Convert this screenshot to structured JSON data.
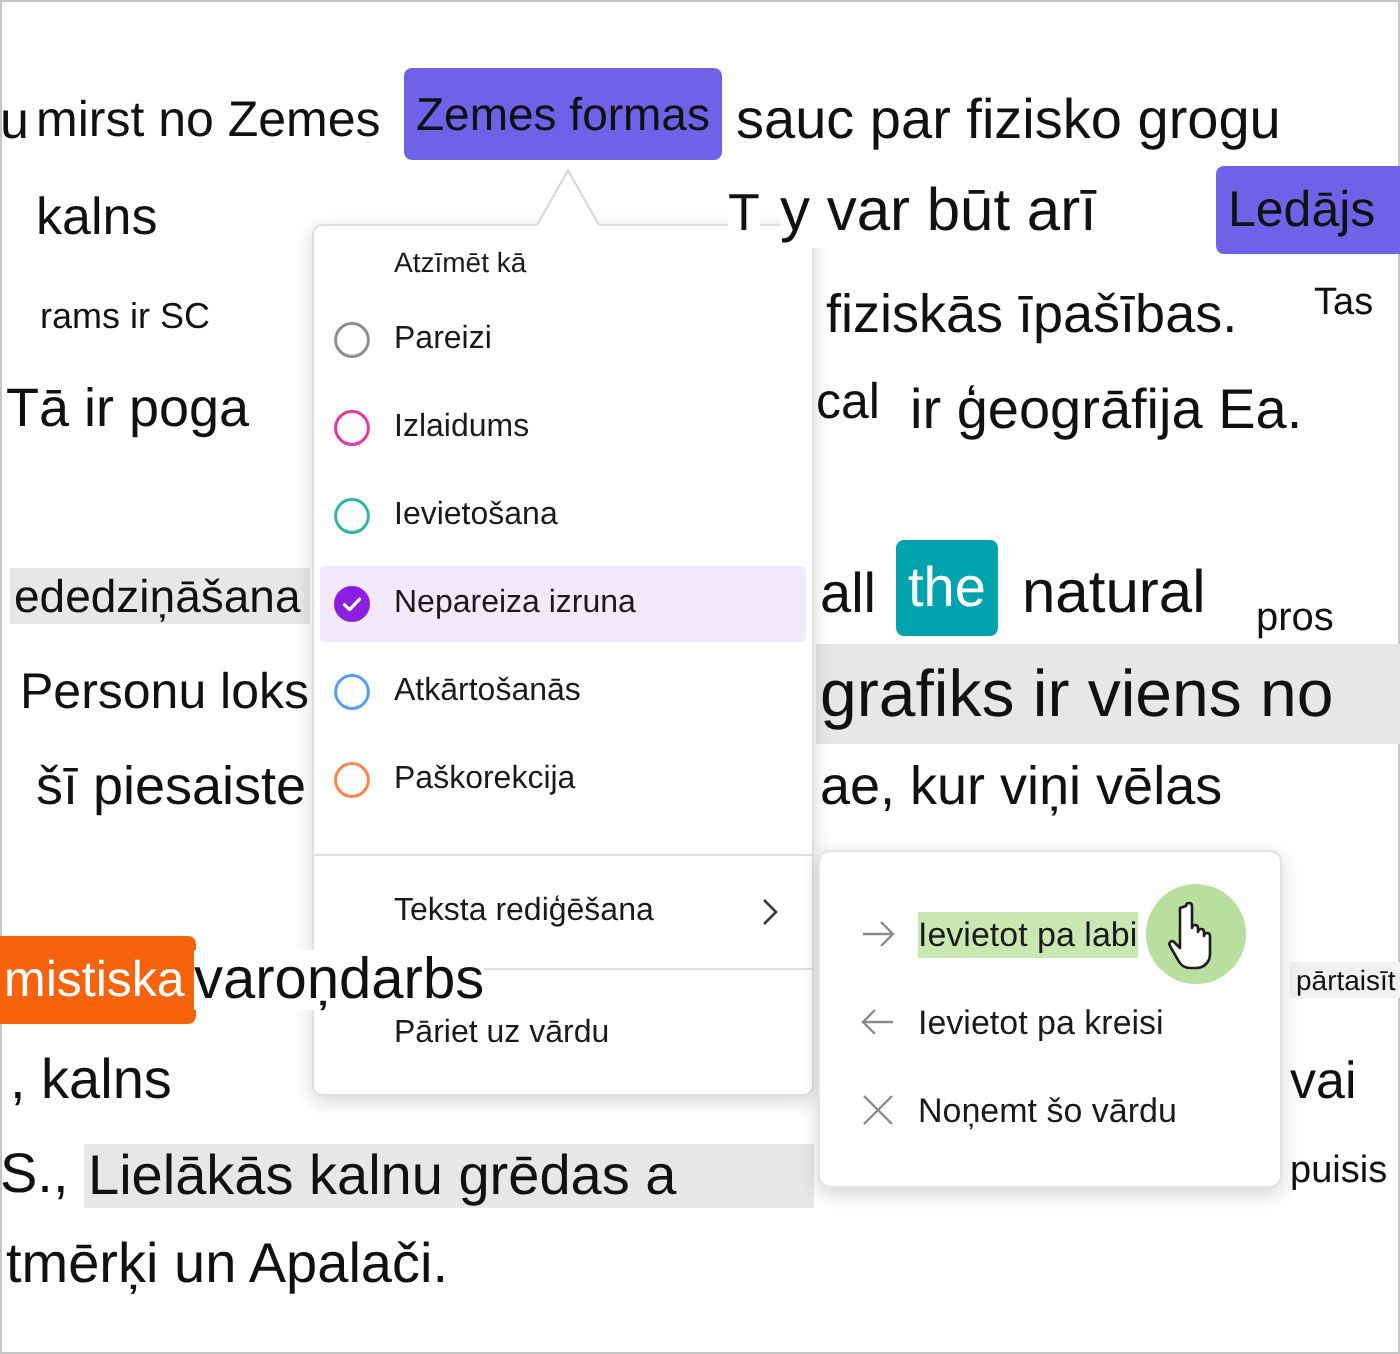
{
  "passage": {
    "lines": [
      {
        "fragments": [
          {
            "text": "u",
            "kind": "plain"
          },
          {
            "text": "mirst no Zemes",
            "kind": "plain"
          },
          {
            "text": "Zemes formas",
            "kind": "mark",
            "color": "#7160e8"
          },
          {
            "text": "sauc par fizisko grogu",
            "kind": "plain"
          }
        ]
      },
      {
        "fragments": [
          {
            "text": "kalns",
            "kind": "plain"
          },
          {
            "text": "T",
            "kind": "plain"
          },
          {
            "text": "y var būt arī",
            "kind": "plain"
          },
          {
            "text": "Ledājs",
            "kind": "mark",
            "color": "#7160e8"
          }
        ]
      },
      {
        "fragments": [
          {
            "text": "rams ir SC",
            "kind": "plain"
          },
          {
            "text": "fiziskās īpašības.",
            "kind": "plain"
          },
          {
            "text": "Tas",
            "kind": "plain"
          }
        ]
      },
      {
        "fragments": [
          {
            "text": "Tā ir poga",
            "kind": "plain"
          },
          {
            "text": "cal",
            "kind": "plain"
          },
          {
            "text": "ir ģeogrāfija Ea.",
            "kind": "plain"
          }
        ]
      },
      {
        "fragments": [
          {
            "text": "ededziņāšana",
            "kind": "shaded"
          },
          {
            "text": "all",
            "kind": "plain"
          },
          {
            "text": "the",
            "kind": "mark-inverse",
            "color": "#00a3ad"
          },
          {
            "text": "natural",
            "kind": "plain"
          },
          {
            "text": "pros",
            "kind": "plain"
          }
        ]
      },
      {
        "fragments": [
          {
            "text": "Personu loks",
            "kind": "plain"
          },
          {
            "text": "grafiks ir viens no",
            "kind": "shaded"
          }
        ]
      },
      {
        "fragments": [
          {
            "text": "šī piesaiste",
            "kind": "plain"
          },
          {
            "text": "ae, kur viņi vēlas",
            "kind": "plain"
          }
        ]
      },
      {
        "fragments": [
          {
            "text": "mistiska",
            "kind": "mark-inverse",
            "color": "#f7630c"
          },
          {
            "text": "varoņdarbs",
            "kind": "plain"
          },
          {
            "text": "pārtaisīt",
            "kind": "tag"
          }
        ]
      },
      {
        "fragments": [
          {
            "text": ", kalns",
            "kind": "plain"
          },
          {
            "text": "vai",
            "kind": "plain"
          }
        ]
      },
      {
        "fragments": [
          {
            "text": "S.,",
            "kind": "plain"
          },
          {
            "text": "Lielākās kalnu grēdas a",
            "kind": "shaded"
          },
          {
            "text": "puisis",
            "kind": "plain"
          }
        ]
      },
      {
        "fragments": [
          {
            "text": "tmērķi un Apalači.",
            "kind": "plain"
          }
        ]
      }
    ]
  },
  "mark_menu": {
    "heading": "Atzīmēt kā",
    "options": [
      {
        "label": "Pareizi",
        "color": "#8f8f8f",
        "selected": false
      },
      {
        "label": "Izlaidums",
        "color": "#e13ba2",
        "selected": false
      },
      {
        "label": "Ievietošana",
        "color": "#35b3b3",
        "selected": false
      },
      {
        "label": "Nepareiza izruna",
        "color": "#8c1fe0",
        "selected": true
      },
      {
        "label": "Atkārtošanās",
        "color": "#5b9df5",
        "selected": false
      },
      {
        "label": "Paškorekcija",
        "color": "#f4894b",
        "selected": false
      }
    ],
    "actions": [
      {
        "label": "Teksta rediģēšana",
        "kind": "submenu"
      },
      {
        "label": "Pāriet uz vārdu",
        "kind": "command"
      }
    ]
  },
  "edit_submenu": {
    "items": [
      {
        "label": "Ievietot pa labi",
        "kind": "right",
        "selected": true
      },
      {
        "label": "Ievietot pa kreisi",
        "kind": "left",
        "selected": false
      },
      {
        "label": "Noņemt šo vārdu",
        "kind": "remove",
        "selected": false
      }
    ]
  }
}
